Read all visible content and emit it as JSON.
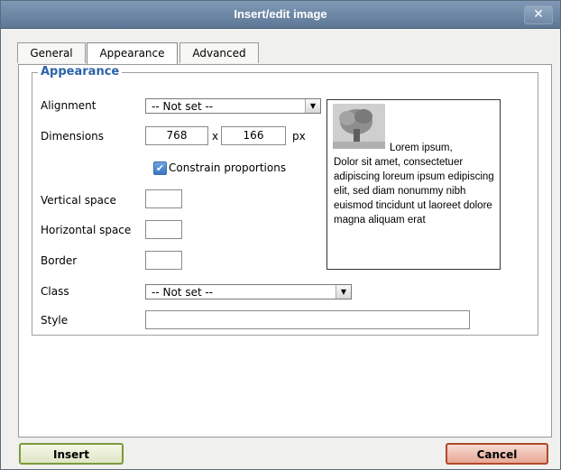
{
  "dialog": {
    "title": "Insert/edit image",
    "close_glyph": "✕"
  },
  "tabs": [
    {
      "label": "General",
      "active": false
    },
    {
      "label": "Appearance",
      "active": true
    },
    {
      "label": "Advanced",
      "active": false
    }
  ],
  "group": {
    "legend": "Appearance"
  },
  "fields": {
    "alignment": {
      "label": "Alignment",
      "value": "-- Not set --"
    },
    "dimensions": {
      "label": "Dimensions",
      "width": "768",
      "sep": "x",
      "height": "166",
      "unit": "px"
    },
    "constrain": {
      "label": "Constrain proportions",
      "checked": true
    },
    "vspace": {
      "label": "Vertical space",
      "value": ""
    },
    "hspace": {
      "label": "Horizontal space",
      "value": ""
    },
    "border": {
      "label": "Border",
      "value": ""
    },
    "class": {
      "label": "Class",
      "value": "-- Not set --"
    },
    "style": {
      "label": "Style",
      "value": ""
    }
  },
  "preview": {
    "text_first": "Lorem ipsum,",
    "text_rest": "Dolor sit amet, consectetuer adipiscing loreum ipsum edipiscing elit, sed diam nonummy nibh euismod tincidunt ut laoreet dolore magna aliquam erat"
  },
  "buttons": {
    "insert": "Insert",
    "cancel": "Cancel"
  },
  "colors": {
    "accent": "#2b63a8",
    "titlebar": "#6a84a3",
    "insert_border": "#7a9a3a",
    "cancel_border": "#b04a2a"
  }
}
